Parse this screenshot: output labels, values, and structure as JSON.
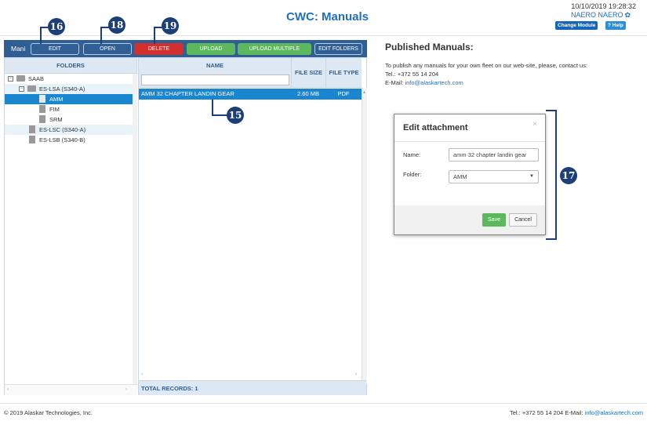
{
  "header": {
    "title": "CWC: Manuals",
    "datetime": "10/10/2019 19:28:32",
    "user": "NAERO NAERO",
    "change_module_label": "Change Module",
    "help_label": "Help"
  },
  "toolbar": {
    "module_label": "Mani",
    "edit_label": "EDIT",
    "open_label": "OPEN",
    "delete_label": "DELETE",
    "upload_label": "UPLOAD",
    "upload_multiple_label": "UPLOAD MULTIPLE",
    "edit_folders_label": "EDIT FOLDERS"
  },
  "folders": {
    "header": "FOLDERS",
    "items": [
      {
        "label": "SAAB",
        "type": "folder",
        "level": 0
      },
      {
        "label": "ES-LSA (S340-A)",
        "type": "folder",
        "level": 1
      },
      {
        "label": "AMM",
        "type": "file",
        "level": 2,
        "selected": true
      },
      {
        "label": "FIM",
        "type": "file",
        "level": 2
      },
      {
        "label": "SRM",
        "type": "file",
        "level": 2
      },
      {
        "label": "ES-LSC (S340-A)",
        "type": "file",
        "level": 1
      },
      {
        "label": "ES-LSB (S340-B)",
        "type": "file",
        "level": 1
      }
    ]
  },
  "grid": {
    "columns": {
      "name": "NAME",
      "size": "FILE SIZE",
      "type": "FILE TYPE"
    },
    "rows": [
      {
        "name": "AMM 32 CHAPTER LANDIN GEAR",
        "size": "2.60 MB",
        "type": "PDF"
      }
    ],
    "total_records": "TOTAL RECORDS: 1"
  },
  "published": {
    "title": "Published Manuals:",
    "text": "To publish any manuals for your own fleet on our web-site, please, contact us:",
    "tel": "Tel.: +372 55 14 204",
    "email_label": "E-Mail:",
    "email": "info@alaskartech.com"
  },
  "modal": {
    "title": "Edit attachment",
    "close": "×",
    "name_label": "Name:",
    "name_value": "amm 32 chapter landin gear",
    "folder_label": "Folder:",
    "folder_value": "AMM",
    "save_label": "Save",
    "cancel_label": "Cancel"
  },
  "callouts": {
    "edit": "16",
    "open": "18",
    "delete": "19",
    "row": "15",
    "modal": "17"
  },
  "footer": {
    "copyright": "© 2019 Alaskar Technologies, Inc.",
    "contact": "Tel.: +372 55 14 204 E-Mail:",
    "email": "info@alaskartech.com"
  },
  "colors": {
    "toolbar": "#2f5f95",
    "selected": "#1a86d0",
    "delete": "#d32f2f",
    "upload": "#5cb85c",
    "callout": "#1c3f78"
  }
}
